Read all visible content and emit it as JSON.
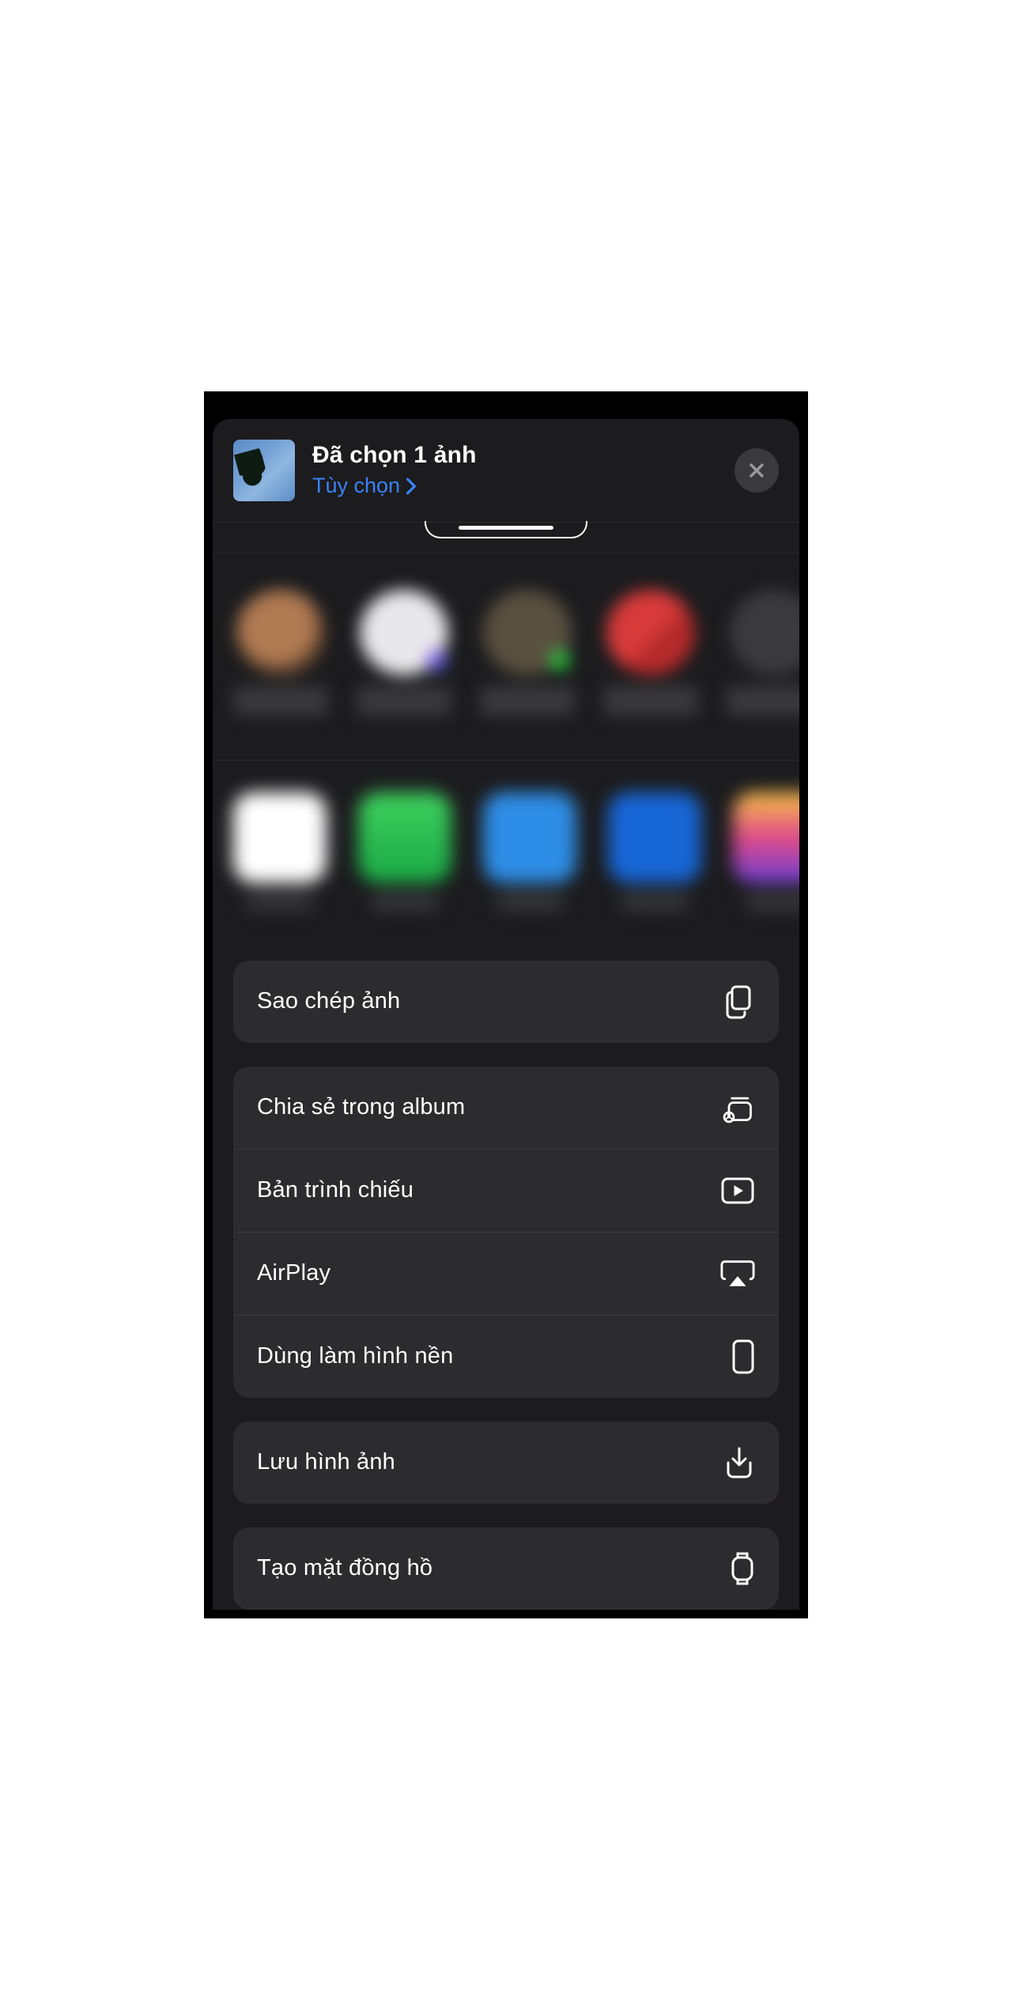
{
  "header": {
    "title": "Đã chọn 1 ảnh",
    "options_label": "Tùy chọn"
  },
  "actions": {
    "copy": "Sao chép ảnh",
    "share_album": "Chia sẻ trong album",
    "slideshow": "Bản trình chiếu",
    "airplay": "AirPlay",
    "wallpaper": "Dùng làm hình nền",
    "save_image": "Lưu hình ảnh",
    "watch_face": "Tạo mặt đồng hồ"
  }
}
